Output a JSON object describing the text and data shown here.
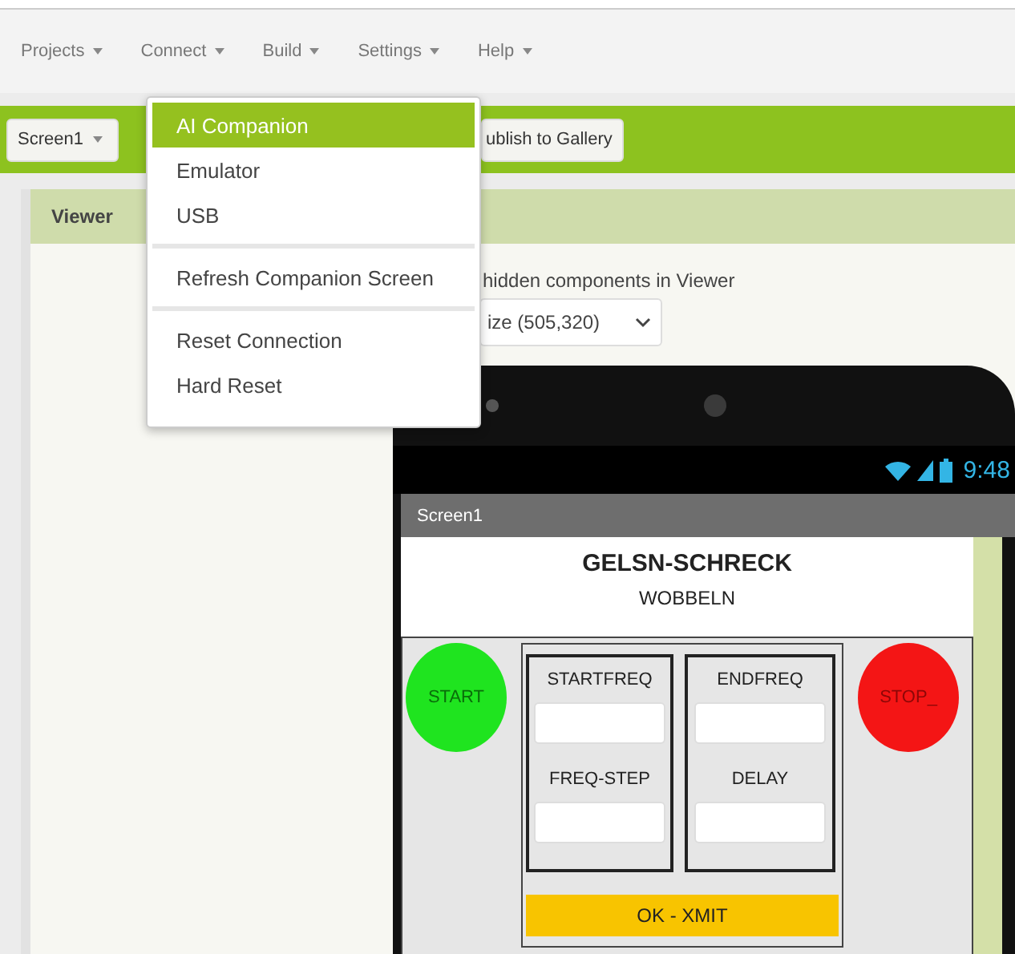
{
  "menu_bar": [
    {
      "label": "Projects"
    },
    {
      "label": "Connect"
    },
    {
      "label": "Build"
    },
    {
      "label": "Settings"
    },
    {
      "label": "Help"
    }
  ],
  "toolbar": {
    "buttons": [
      {
        "label": "Screen1",
        "dropdown": true
      },
      {
        "label": "ublish to Gallery",
        "dropdown": false
      }
    ]
  },
  "connect_menu": {
    "groups": [
      {
        "items": [
          {
            "label": "AI Companion",
            "selected": true
          },
          {
            "label": "Emulator",
            "selected": false
          },
          {
            "label": "USB",
            "selected": false
          }
        ]
      },
      {
        "items": [
          {
            "label": "Refresh Companion Screen",
            "selected": false
          }
        ]
      },
      {
        "items": [
          {
            "label": "Reset Connection",
            "selected": false
          },
          {
            "label": "Hard Reset",
            "selected": false
          }
        ]
      }
    ]
  },
  "viewer": {
    "title": "Viewer",
    "hidden_components_label": "hidden components in Viewer",
    "screen_size": "ize (505,320)"
  },
  "phone": {
    "time": "9:48",
    "screen_title": "Screen1",
    "app": {
      "title": "GELSN-SCHRECK",
      "subtitle": "WOBBELN",
      "start_button": "START",
      "stop_button": "STOP_",
      "columns": [
        {
          "fields": [
            {
              "label": "STARTFREQ"
            },
            {
              "label": "FREQ-STEP"
            }
          ]
        },
        {
          "fields": [
            {
              "label": "ENDFREQ"
            },
            {
              "label": "DELAY"
            }
          ]
        }
      ],
      "submit_button": "OK - XMIT"
    }
  }
}
